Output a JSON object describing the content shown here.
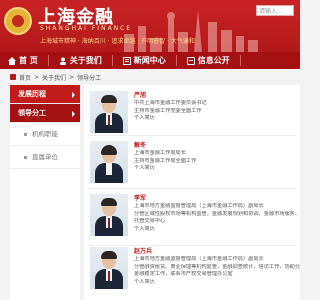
{
  "header": {
    "brand_cn": "上海金融",
    "brand_en": "SHANGHAI FINANCE",
    "slogan": "上海城市精神 · 海纳百川 · 追求卓越 · 开明睿智 · 大气谦和",
    "search_placeholder": "请输入…"
  },
  "nav": {
    "items": [
      {
        "label": "首  页",
        "icon": "home-icon"
      },
      {
        "label": "关于我们",
        "icon": "people-icon"
      },
      {
        "label": "新闻中心",
        "icon": "news-icon"
      },
      {
        "label": "信息公开",
        "icon": "info-icon"
      }
    ]
  },
  "breadcrumb": {
    "home": "首页",
    "sep": ">",
    "level1": "关于我们",
    "level2": "领导分工"
  },
  "sidebar": {
    "items": [
      {
        "label": "发展历程",
        "active": false
      },
      {
        "label": "领导分工",
        "active": true
      }
    ],
    "subitems": [
      "机构职能",
      "直属单位"
    ]
  },
  "people": [
    {
      "name": "严旭",
      "lines": [
        "中共上海市金融工作委员会书记",
        "主持市金融工作党委全面工作",
        "个人简历"
      ]
    },
    {
      "name": "解冬",
      "lines": [
        "上海市金融工作局局长",
        "主持市金融工作局全面工作",
        "个人简历"
      ]
    },
    {
      "name": "李军",
      "lines": [
        "上海市地方金融监督管理局（上海市金融工作局）副局长",
        "分管区域性股权市场等机构监管，金融发展规划和协调、金融市场服务、",
        "托管交易中心",
        "个人简历"
      ]
    },
    {
      "name": "赵万兵",
      "lines": [
        "上海市地方金融监督管理局（上海市金融工作局）副局长",
        "分管融资租赁、商业保理等机构监管，金融调查统计、信访工作，协助分管",
        "金融稳定工作，联系市产权交易管理办公室",
        "个人简历"
      ]
    }
  ],
  "colors": {
    "brand_red": "#c11b1c",
    "nav_red": "#a51012",
    "gold": "#e7b437"
  }
}
